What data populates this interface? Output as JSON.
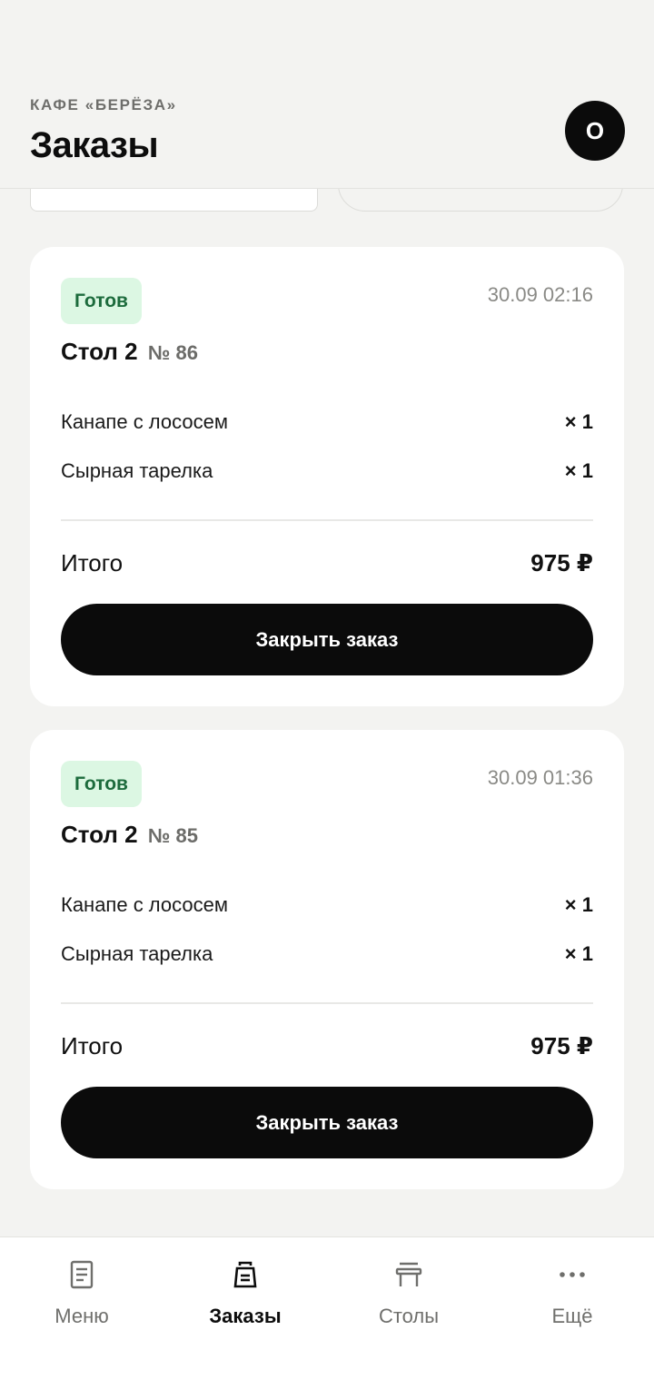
{
  "header": {
    "cafe_name": "КАФЕ «БЕРЁЗА»",
    "title": "Заказы",
    "avatar_initial": "О"
  },
  "orders": [
    {
      "status": "Готов",
      "time": "30.09 02:16",
      "table": "Стол 2",
      "number": "№ 86",
      "items": [
        {
          "name": "Канапе с лососем",
          "qty": "× 1"
        },
        {
          "name": "Сырная тарелка",
          "qty": "× 1"
        }
      ],
      "total_label": "Итого",
      "total": "975 ₽",
      "action": "Закрыть заказ"
    },
    {
      "status": "Готов",
      "time": "30.09 01:36",
      "table": "Стол 2",
      "number": "№ 85",
      "items": [
        {
          "name": "Канапе с лососем",
          "qty": "× 1"
        },
        {
          "name": "Сырная тарелка",
          "qty": "× 1"
        }
      ],
      "total_label": "Итого",
      "total": "975 ₽",
      "action": "Закрыть заказ"
    }
  ],
  "nav": [
    {
      "label": "Меню",
      "icon": "menu-document-icon",
      "active": false
    },
    {
      "label": "Заказы",
      "icon": "order-bag-icon",
      "active": true
    },
    {
      "label": "Столы",
      "icon": "table-icon",
      "active": false
    },
    {
      "label": "Ещё",
      "icon": "more-dots-icon",
      "active": false
    }
  ],
  "colors": {
    "background": "#f3f3f1",
    "card": "#ffffff",
    "badge_bg": "#dcf7e3",
    "badge_text": "#1c6b3c",
    "primary_button": "#0b0b0b"
  }
}
